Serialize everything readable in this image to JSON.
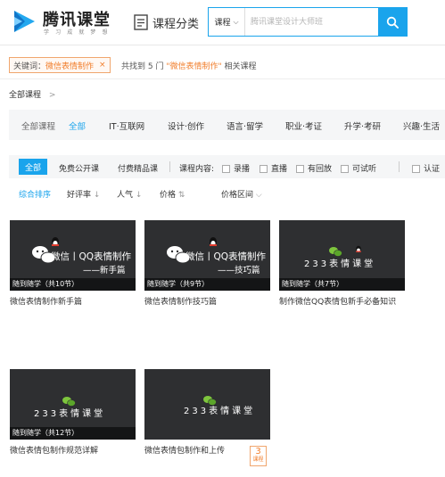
{
  "header": {
    "logo_name": "腾讯课堂",
    "logo_slogan": "学 习 成 就 梦 想",
    "category_button": "课程分类",
    "search_type": "课程",
    "search_placeholder": "腾讯课堂设计大师班",
    "brand_color": "#1aa4ec"
  },
  "keyword": {
    "label": "关键词：",
    "value": "微信表情制作",
    "close": "×"
  },
  "result": {
    "prefix": "共找到 5 门",
    "keyword": "\"微信表情制作\"",
    "suffix": "相关课程"
  },
  "breadcrumb": {
    "label": "全部课程",
    "arrow": ">"
  },
  "categories": {
    "header": "全部课程",
    "items": [
      "全部",
      "IT·互联网",
      "设计·创作",
      "语言·留学",
      "职业·考证",
      "升学·考研",
      "兴趣·生活"
    ],
    "active_index": 0
  },
  "filters": {
    "all": "全部",
    "free": "免费公开课",
    "paid": "付费精品课",
    "content_label": "课程内容:",
    "options": [
      "录播",
      "直播",
      "有回放",
      "可试听",
      "认证"
    ],
    "options_checked": [
      false,
      false,
      false,
      false,
      false
    ]
  },
  "sort": {
    "default": "综合排序",
    "rating": "好评率",
    "popularity": "人气",
    "price": "价格",
    "price_range": "价格区间",
    "down_arrow": "↓",
    "updown_arrow": "⇅",
    "chevron": "⌵"
  },
  "courses": [
    {
      "label": "随到随学（共10节）",
      "title": "微信表情制作新手篇",
      "thumb_main": "微信丨QQ表情制作",
      "thumb_sub": "——新手篇"
    },
    {
      "label": "随到随学（共9节）",
      "title": "微信表情制作技巧篇",
      "thumb_main": "微信丨QQ表情制作",
      "thumb_sub": "——技巧篇"
    },
    {
      "label": "随到随学（共7节）",
      "title": "制作微信QQ表情包新手必备知识",
      "thumb_main": "233表情课堂",
      "thumb_sub": ""
    },
    {
      "label": "随到随学（共12节）",
      "title": "微信表情包制作规范详解",
      "thumb_main": "233表情课堂",
      "thumb_sub": ""
    },
    {
      "label": "",
      "title": "微信表情包制作和上传",
      "thumb_main": "233表情课堂",
      "thumb_sub": ""
    }
  ],
  "badge": {
    "number": "3",
    "text": "课程"
  }
}
